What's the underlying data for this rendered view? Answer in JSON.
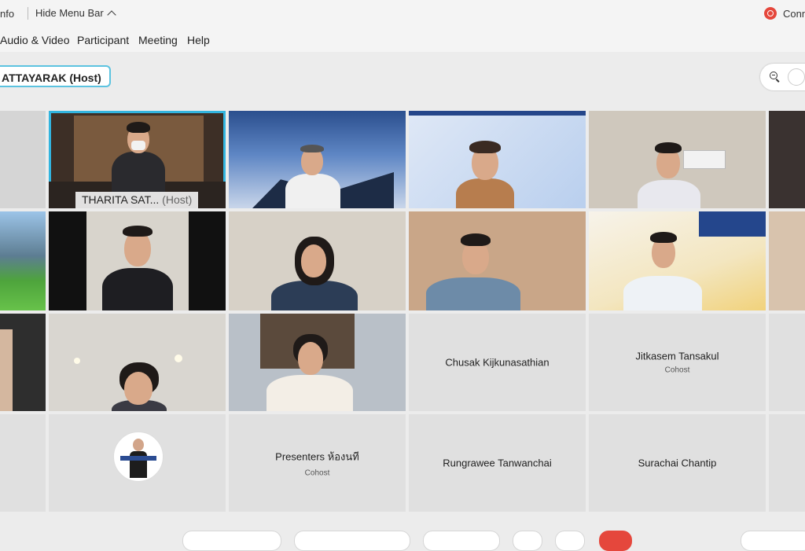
{
  "topbar": {
    "info_label": "nfo",
    "hide_menu_label": "Hide Menu Bar",
    "connection_label": "Conn"
  },
  "menu": {
    "items": [
      "Audio & Video",
      "Participant",
      "Meeting",
      "Help"
    ]
  },
  "active_speaker": {
    "label": "ATTAYARAK (Host)"
  },
  "tiles": {
    "host_name": "THARITA SAT...",
    "host_role": "(Host)",
    "chusak": {
      "name": "Chusak Kijkunasathian"
    },
    "jitkasem": {
      "name": "Jitkasem Tansakul",
      "role": "Cohost"
    },
    "presenters": {
      "name": "Presenters ห้องนที",
      "role": "Cohost"
    },
    "rungrawee": {
      "name": "Rungrawee Tanwanchai"
    },
    "surachai": {
      "name": "Surachai Chantip"
    }
  },
  "colors": {
    "accent": "#33b5df",
    "record": "#e5473c",
    "tile_bg": "#e0e0e0"
  }
}
